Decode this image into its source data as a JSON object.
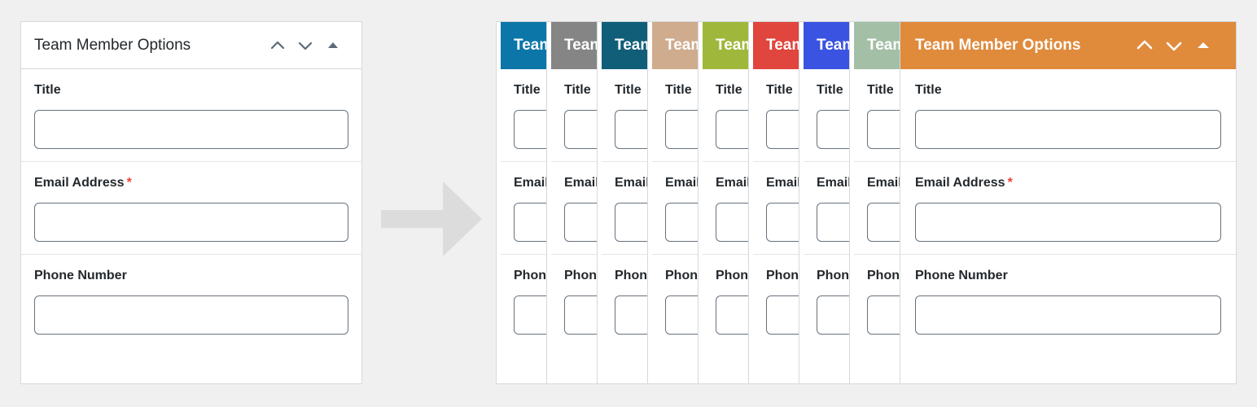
{
  "page": {
    "background_color": "#f0f0f0",
    "arrow_color": "#dcdcdc",
    "panel_border_color": "#d5d8dc",
    "input_border_color": "#68727e",
    "required_color": "#ef4136",
    "text_color": "#23282d",
    "icon_color": "#5a6a78"
  },
  "left_panel": {
    "title": "Team Member Options",
    "header_icons": [
      {
        "name": "chevron-up-icon",
        "glyph": "chevron-up"
      },
      {
        "name": "chevron-down-icon",
        "glyph": "chevron-down"
      },
      {
        "name": "collapse-triangle-icon",
        "glyph": "triangle-up"
      }
    ],
    "fields": [
      {
        "label": "Title",
        "required": false,
        "value": "",
        "placeholder": ""
      },
      {
        "label": "Email Address",
        "required": true,
        "required_mark": "*",
        "value": "",
        "placeholder": ""
      },
      {
        "label": "Phone Number",
        "required": false,
        "value": "",
        "placeholder": ""
      }
    ]
  },
  "arrow": {
    "name": "right-arrow-graphic",
    "direction": "right"
  },
  "right_group": {
    "active_panel": {
      "title": "Team Member Options",
      "header_color": "#e08a3c",
      "header_icons": [
        {
          "name": "chevron-up-icon",
          "glyph": "chevron-up"
        },
        {
          "name": "chevron-down-icon",
          "glyph": "chevron-down"
        },
        {
          "name": "collapse-triangle-icon",
          "glyph": "triangle-up"
        }
      ],
      "fields": [
        {
          "label": "Title",
          "required": false,
          "value": "",
          "placeholder": ""
        },
        {
          "label": "Email Address",
          "required": true,
          "required_mark": "*",
          "value": "",
          "placeholder": ""
        },
        {
          "label": "Phone Number",
          "required": false,
          "value": "",
          "placeholder": ""
        }
      ]
    },
    "collapsed_panels": [
      {
        "title": "Team Member Options",
        "header_color": "#0c76a8"
      },
      {
        "title": "Team Member Options",
        "header_color": "#858585"
      },
      {
        "title": "Team Member Options",
        "header_color": "#115e78"
      },
      {
        "title": "Team Member Options",
        "header_color": "#cfac8e"
      },
      {
        "title": "Team Member Options",
        "header_color": "#9fb83c"
      },
      {
        "title": "Team Member Options",
        "header_color": "#e0453e"
      },
      {
        "title": "Team Member Options",
        "header_color": "#3a53e0"
      },
      {
        "title": "Team Member Options",
        "header_color": "#a3bfa6"
      }
    ],
    "collapsed_fields": [
      {
        "label": "Title",
        "required": false,
        "value": ""
      },
      {
        "label": "Email Address",
        "required": true,
        "required_mark": "*",
        "value": ""
      },
      {
        "label": "Phone Number",
        "required": false,
        "value": ""
      }
    ]
  }
}
